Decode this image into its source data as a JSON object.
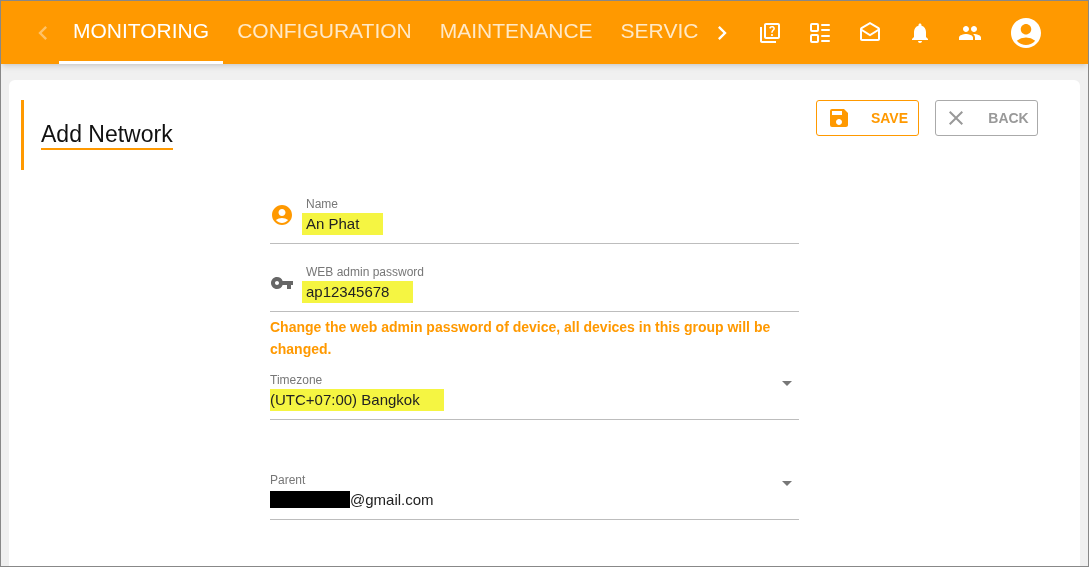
{
  "tabs": [
    {
      "label": "MONITORING",
      "selected": true
    },
    {
      "label": "CONFIGURATION",
      "selected": false
    },
    {
      "label": "MAINTENANCE",
      "selected": false
    },
    {
      "label": "SERVIC",
      "selected": false
    }
  ],
  "page_title": "Add Network",
  "buttons": [
    {
      "label": "SAVE",
      "kind": "primary"
    },
    {
      "label": "BACK",
      "kind": "secondary"
    }
  ],
  "fields": [
    {
      "kind": "text",
      "label": "Name",
      "value": "An Phat",
      "highlighted": true
    },
    {
      "kind": "text",
      "label": "WEB admin password",
      "value": "ap12345678",
      "highlighted": true
    },
    {
      "kind": "warning",
      "text": "Change the web admin password of device, all devices in this group will be changed."
    },
    {
      "kind": "select",
      "label": "Timezone",
      "value": "(UTC+07:00) Bangkok",
      "highlighted": true,
      "redacted": false
    },
    {
      "kind": "select",
      "label": "Parent",
      "value": "@gmail.com",
      "highlighted": false,
      "redacted": true
    }
  ]
}
